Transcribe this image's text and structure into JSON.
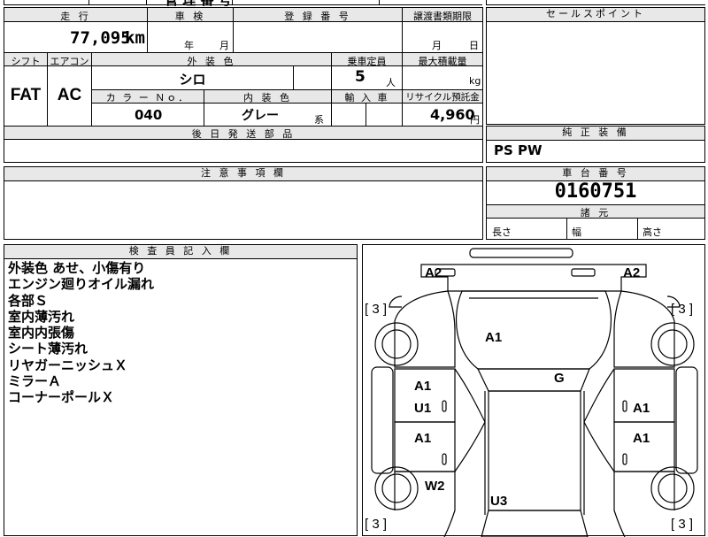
{
  "top_fragment": "管 理 番 号",
  "mileage": {
    "header": "走 行",
    "value": "77,095",
    "unit": "km"
  },
  "shaken": {
    "header": "車 検",
    "year": "年",
    "month": "月"
  },
  "registration": {
    "header": "登 録 番 号"
  },
  "transfer": {
    "header": "譲渡書類期限",
    "month": "月",
    "day": "日"
  },
  "sales_point": {
    "header": "セールスポイント"
  },
  "shift": {
    "header": "シフト",
    "value": "FAT"
  },
  "aircon": {
    "header": "エアコン",
    "value": "AC"
  },
  "exterior_color": {
    "header": "外 装 色",
    "value": "シロ"
  },
  "capacity": {
    "header": "乗車定員",
    "value": "5",
    "unit": "人"
  },
  "max_load": {
    "header": "最大積載量",
    "unit": "kg"
  },
  "color_no": {
    "header": "カ ラ ー Ｎｏ．",
    "value": "040"
  },
  "interior_color": {
    "header": "内 装 色",
    "value": "グレー",
    "suffix": "系"
  },
  "import": {
    "header": "輸 入 車"
  },
  "recycle": {
    "header": "リサイクル預託金",
    "value": "4,960",
    "unit": "円"
  },
  "later_parts": {
    "header": "後 日 発 送 部 品"
  },
  "equipment": {
    "header": "純 正 装 備",
    "value": "PS PW"
  },
  "notes_section": {
    "header": "注 意 事 項 欄"
  },
  "chassis": {
    "header": "車 台 番 号",
    "value": "0160751"
  },
  "dimensions": {
    "header": "諸 元",
    "length": "長さ",
    "width": "幅",
    "height": "高さ"
  },
  "inspector": {
    "header": "検 査 員 記 入 欄",
    "lines": [
      "外装色 あせ、小傷有り",
      "エンジン廻りオイル漏れ",
      "各部Ｓ",
      "室内薄汚れ",
      "室内内張傷",
      "シート薄汚れ",
      "リヤガーニッシュＸ",
      "ミラーＡ",
      "コーナーポールＸ"
    ]
  },
  "diagram": {
    "a2_left": "A2",
    "a2_right": "A2",
    "tread_fl": "[ 3 ]",
    "tread_fr": "[ 3 ]",
    "tread_rl": "[ 3 ]",
    "tread_rr": "[ 3 ]",
    "hood": "A1",
    "roof": "G",
    "front_door_l1": "A1",
    "front_door_l2": "U1",
    "front_door_r": "A1",
    "rear_door_l": "A1",
    "rear_door_r": "A1",
    "rear_fender_l": "W2",
    "trunk": "U3"
  }
}
